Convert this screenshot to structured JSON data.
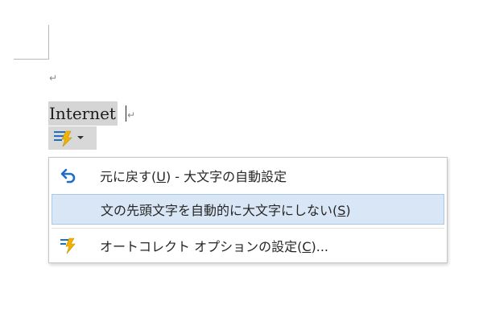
{
  "document": {
    "paragraph_mark": "↵",
    "word": "Internet",
    "word_paragraph_mark": "↵"
  },
  "autocorrect_options": {
    "icon": "lightning-bolt-autocorrect-icon",
    "arrow": "dropdown-arrow-icon"
  },
  "menu": {
    "items": [
      {
        "icon": "undo-arrow-icon",
        "label_pre": "元に戻す(",
        "accel": "U",
        "label_post": ") - 大文字の自動設定"
      },
      {
        "icon": "",
        "label_pre": "文の先頭文字を自動的に大文字にしない(",
        "accel": "S",
        "label_post": ")"
      },
      {
        "icon": "lightning-bolt-autocorrect-icon",
        "label_pre": "オートコレクト オプションの設定(",
        "accel": "C",
        "label_post": ")..."
      }
    ]
  },
  "colors": {
    "highlight": "#d8e6f5",
    "highlight_border": "#a9c8ec",
    "undo_blue": "#1f6fc5",
    "bolt_yellow": "#f0b400",
    "text": "#262626"
  }
}
